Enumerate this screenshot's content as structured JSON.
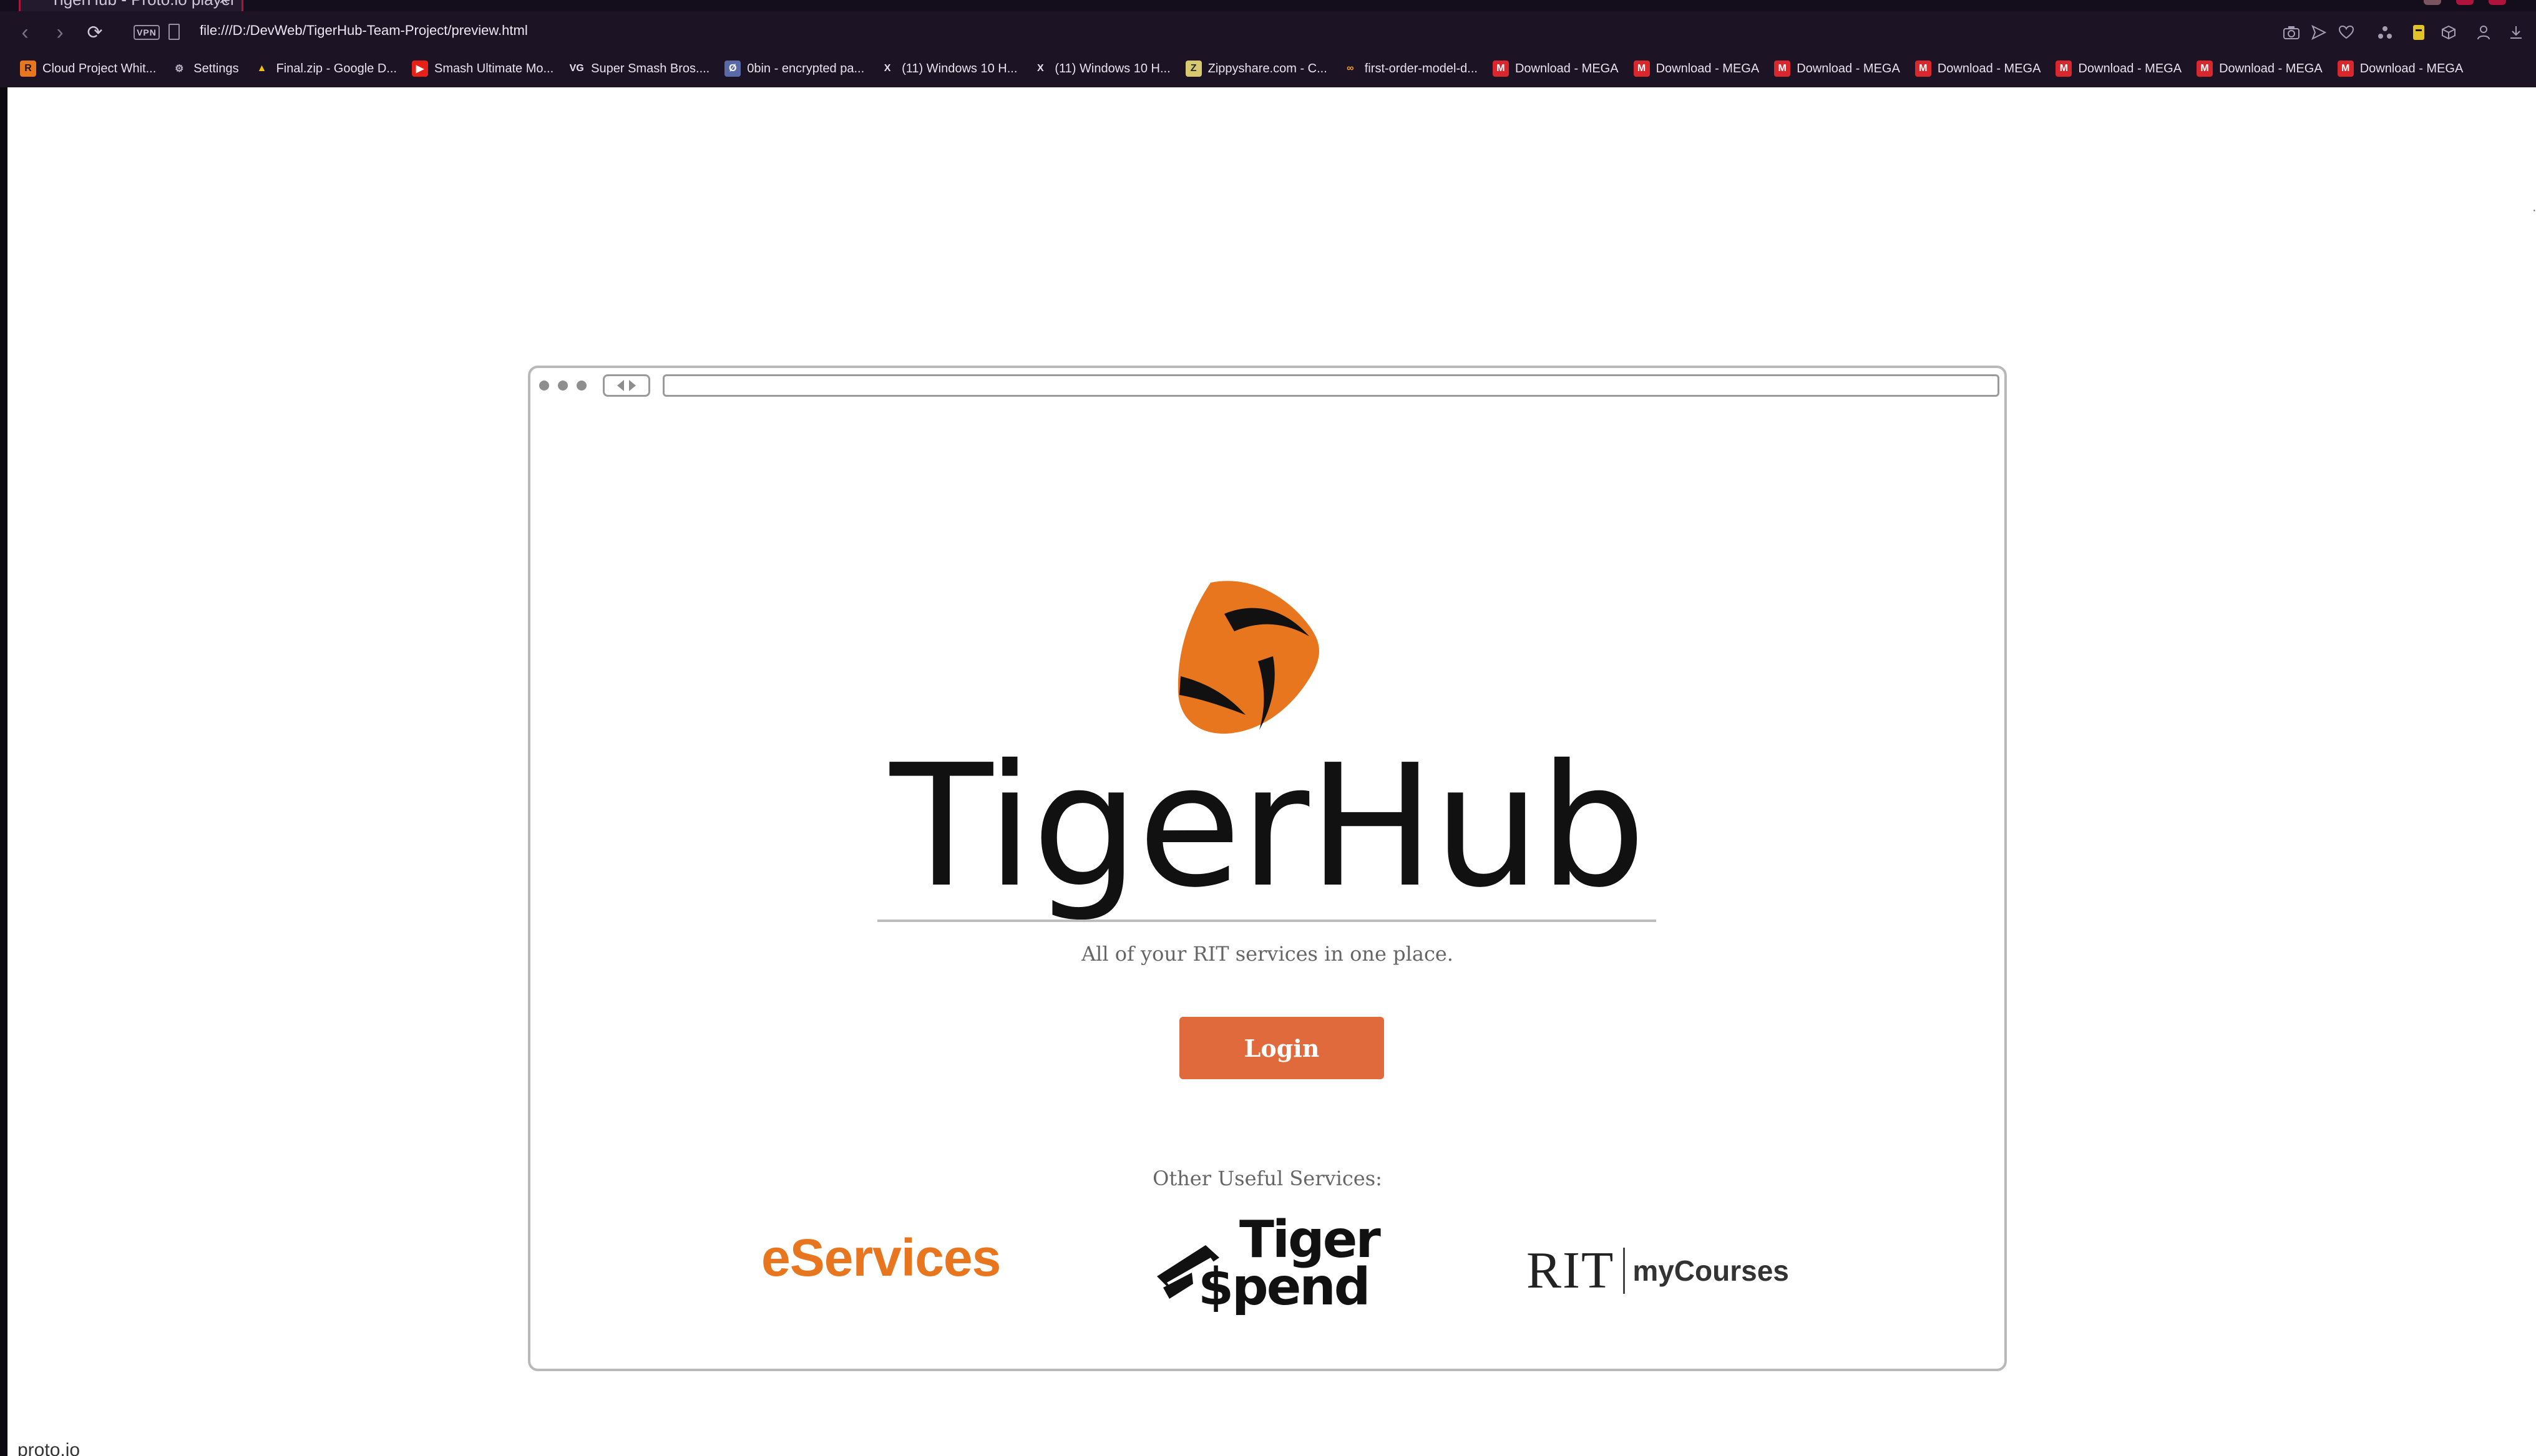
{
  "browser": {
    "tab": {
      "title": "TigerHub - Proto.io player",
      "close_glyph": "×"
    },
    "nav": {
      "back_glyph": "‹",
      "forward_glyph": "›",
      "reload_glyph": "⟳"
    },
    "vpn_label": "VPN",
    "url": "file:///D:/DevWeb/TigerHub-Team-Project/preview.html",
    "toolbar_icons": [
      "camera-icon",
      "send-icon",
      "heart-icon",
      "extensions-icon",
      "wallet-icon",
      "cube-icon",
      "profile-icon",
      "download-icon"
    ],
    "bookmarks": [
      {
        "label": "Cloud Project Whit...",
        "icon": "R",
        "icon_bg": "#e8761e",
        "icon_fg": "#1c1424"
      },
      {
        "label": "Settings",
        "icon": "⚙",
        "icon_bg": "transparent",
        "icon_fg": "#bdb4c8"
      },
      {
        "label": "Final.zip - Google D...",
        "icon": "▲",
        "icon_bg": "transparent",
        "icon_fg": "#f4c20d"
      },
      {
        "label": "Smash Ultimate Mo...",
        "icon": "▶",
        "icon_bg": "#e62117",
        "icon_fg": "#ffffff"
      },
      {
        "label": "Super Smash Bros....",
        "icon": "VG",
        "icon_bg": "transparent",
        "icon_fg": "#e8e2ee"
      },
      {
        "label": "0bin - encrypted pa...",
        "icon": "Ø",
        "icon_bg": "#5a6aa8",
        "icon_fg": "#ffffff"
      },
      {
        "label": "(11) Windows 10 H...",
        "icon": "X",
        "icon_bg": "transparent",
        "icon_fg": "#e8e2ee"
      },
      {
        "label": "(11) Windows 10 H...",
        "icon": "X",
        "icon_bg": "transparent",
        "icon_fg": "#e8e2ee"
      },
      {
        "label": "Zippyshare.com - C...",
        "icon": "Z",
        "icon_bg": "#d8c870",
        "icon_fg": "#2a2a2a"
      },
      {
        "label": "first-order-model-d...",
        "icon": "∞",
        "icon_bg": "transparent",
        "icon_fg": "#f2a21b"
      },
      {
        "label": "Download - MEGA",
        "icon": "M",
        "icon_bg": "#d9272e",
        "icon_fg": "#ffffff"
      },
      {
        "label": "Download - MEGA",
        "icon": "M",
        "icon_bg": "#d9272e",
        "icon_fg": "#ffffff"
      },
      {
        "label": "Download - MEGA",
        "icon": "M",
        "icon_bg": "#d9272e",
        "icon_fg": "#ffffff"
      },
      {
        "label": "Download - MEGA",
        "icon": "M",
        "icon_bg": "#d9272e",
        "icon_fg": "#ffffff"
      },
      {
        "label": "Download - MEGA",
        "icon": "M",
        "icon_bg": "#d9272e",
        "icon_fg": "#ffffff"
      },
      {
        "label": "Download - MEGA",
        "icon": "M",
        "icon_bg": "#d9272e",
        "icon_fg": "#ffffff"
      },
      {
        "label": "Download - MEGA",
        "icon": "M",
        "icon_bg": "#d9272e",
        "icon_fg": "#ffffff"
      }
    ]
  },
  "page": {
    "brand_title": "TigerHub",
    "tagline": "All of your RIT services in one place.",
    "login_label": "Login",
    "other_services_label": "Other Useful Services:",
    "services": {
      "eservices": "eServices",
      "tigerspend_line1": "Tiger",
      "tigerspend_line2": "$pend",
      "mycourses_rit": "RIT",
      "mycourses_text": "myCourses"
    },
    "footer_brand": "proto.io"
  },
  "colors": {
    "accent_orange": "#e06a3c",
    "logo_orange": "#e8761e",
    "chrome_bg": "#1c1424",
    "tab_accent": "#b0143c"
  }
}
